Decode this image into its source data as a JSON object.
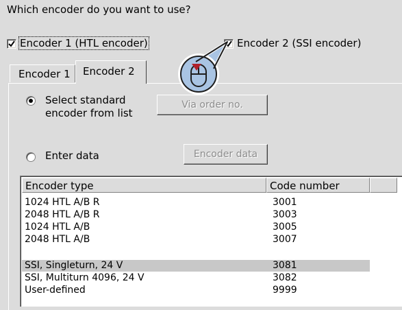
{
  "question": "Which encoder do you want to use?",
  "checkboxes": [
    {
      "label": "Encoder 1 (HTL encoder)",
      "checked": true
    },
    {
      "label": "Encoder 2 (SSI encoder)",
      "checked": true
    }
  ],
  "tabs": [
    {
      "label": "Encoder 1",
      "active": false
    },
    {
      "label": "Encoder 2",
      "active": true
    }
  ],
  "options": {
    "standard_label_line1": "Select standard",
    "standard_label_line2": "encoder from list",
    "standard_selected": true,
    "via_order_button": "Via order no.",
    "enter_data_label": "Enter data",
    "enter_data_selected": false,
    "encoder_data_button": "Encoder data"
  },
  "table": {
    "columns": [
      "Encoder type",
      "Code number"
    ],
    "rows": [
      {
        "type": "1024 HTL A/B R",
        "code": "3001"
      },
      {
        "type": "2048 HTL A/B R",
        "code": "3003"
      },
      {
        "type": "1024 HTL A/B",
        "code": "3005"
      },
      {
        "type": "2048 HTL A/B",
        "code": "3007"
      },
      {
        "type": "SSI, Singleturn, 24 V",
        "code": "3081",
        "selected": true
      },
      {
        "type": "SSI, Multiturn 4096, 24 V",
        "code": "3082"
      },
      {
        "type": "User-defined",
        "code": "9999"
      }
    ]
  },
  "colors": {
    "background": "#dcdcdc",
    "selection": "#c8c8c8",
    "cursor_marker": "#b0202a",
    "callout_fill": "#a9c4e3"
  },
  "icons": {
    "checkmark": "check-icon",
    "cursor": "mouse-click-icon"
  }
}
